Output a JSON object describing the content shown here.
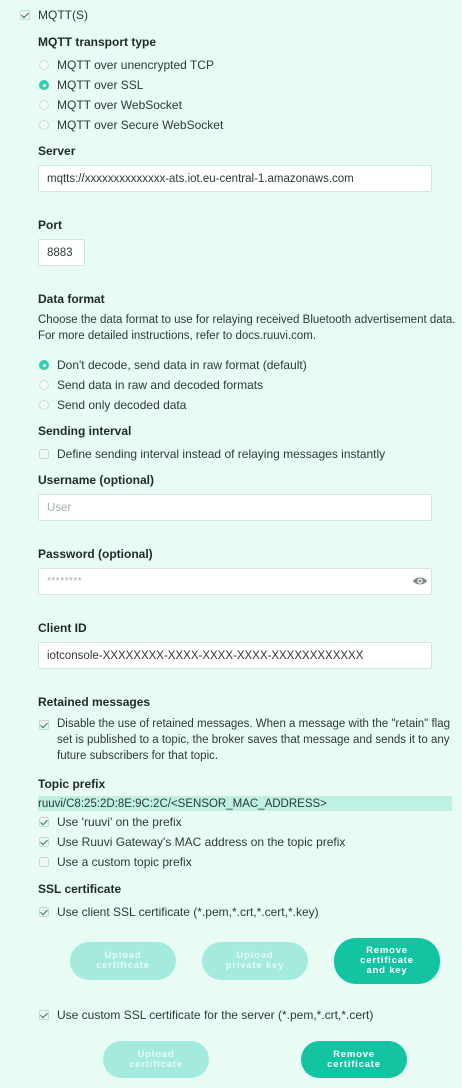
{
  "mqtt_checkbox": {
    "label": "MQTT(S)",
    "checked": true
  },
  "transport": {
    "heading": "MQTT transport type",
    "options": [
      {
        "label": "MQTT over unencrypted TCP",
        "selected": false
      },
      {
        "label": "MQTT over SSL",
        "selected": true
      },
      {
        "label": "MQTT over WebSocket",
        "selected": false
      },
      {
        "label": "MQTT over Secure WebSocket",
        "selected": false
      }
    ]
  },
  "server": {
    "heading": "Server",
    "value": "mqtts://xxxxxxxxxxxxxx-ats.iot.eu-central-1.amazonaws.com"
  },
  "port": {
    "heading": "Port",
    "value": "8883"
  },
  "data_format": {
    "heading": "Data format",
    "description_line1": "Choose the data format to use for relaying received Bluetooth advertisement data.",
    "description_line2": "For more detailed instructions, refer to docs.ruuvi.com.",
    "options": [
      {
        "label": "Don't decode, send data in raw format (default)",
        "selected": true
      },
      {
        "label": "Send data in raw and decoded formats",
        "selected": false
      },
      {
        "label": "Send only decoded data",
        "selected": false
      }
    ]
  },
  "sending_interval": {
    "heading": "Sending interval",
    "checkbox_label": "Define sending interval instead of relaying messages instantly",
    "checked": false
  },
  "username": {
    "heading": "Username (optional)",
    "placeholder": "User"
  },
  "password": {
    "heading": "Password (optional)",
    "value": "********",
    "eye_icon": "eye-icon"
  },
  "client_id": {
    "heading": "Client ID",
    "value": "iotconsole-XXXXXXXX-XXXX-XXXX-XXXX-XXXXXXXXXXXX"
  },
  "retained": {
    "heading": "Retained messages",
    "line1": "Disable the use of retained messages. When a message with the \"retain\" flag",
    "line2": "set is published to a topic, the broker saves that message and sends it to any",
    "line3": "future subscribers for that topic.",
    "checked": true
  },
  "topic_prefix": {
    "heading": "Topic prefix",
    "value": "ruuvi/C8:25:2D:8E:9C:2C/<SENSOR_MAC_ADDRESS>",
    "options": [
      {
        "label": "Use 'ruuvi' on the prefix",
        "checked": true
      },
      {
        "label": "Use Ruuvi Gateway's MAC address on the topic prefix",
        "checked": true
      },
      {
        "label": "Use a custom topic prefix",
        "checked": false
      }
    ]
  },
  "ssl": {
    "heading": "SSL certificate",
    "client_cert_label": "Use client SSL certificate (*.pem,*.crt,*.cert,*.key)",
    "client_cert_checked": true,
    "buttons1": {
      "upload_cert_l1": "Upload",
      "upload_cert_l2": "certificate",
      "upload_key_l1": "Upload",
      "upload_key_l2": "private key",
      "remove_l1": "Remove",
      "remove_l2": "certificate",
      "remove_l3": "and key"
    },
    "server_cert_label": "Use custom SSL certificate for the server (*.pem,*.crt,*.cert)",
    "server_cert_checked": true,
    "buttons2": {
      "upload_cert_l1": "Upload",
      "upload_cert_l2": "certificate",
      "remove_l1": "Remove",
      "remove_l2": "certificate"
    }
  },
  "colors": {
    "accent": "#13c4a2",
    "accent_disabled": "#a4ebdd",
    "background": "#e8fbf5"
  }
}
